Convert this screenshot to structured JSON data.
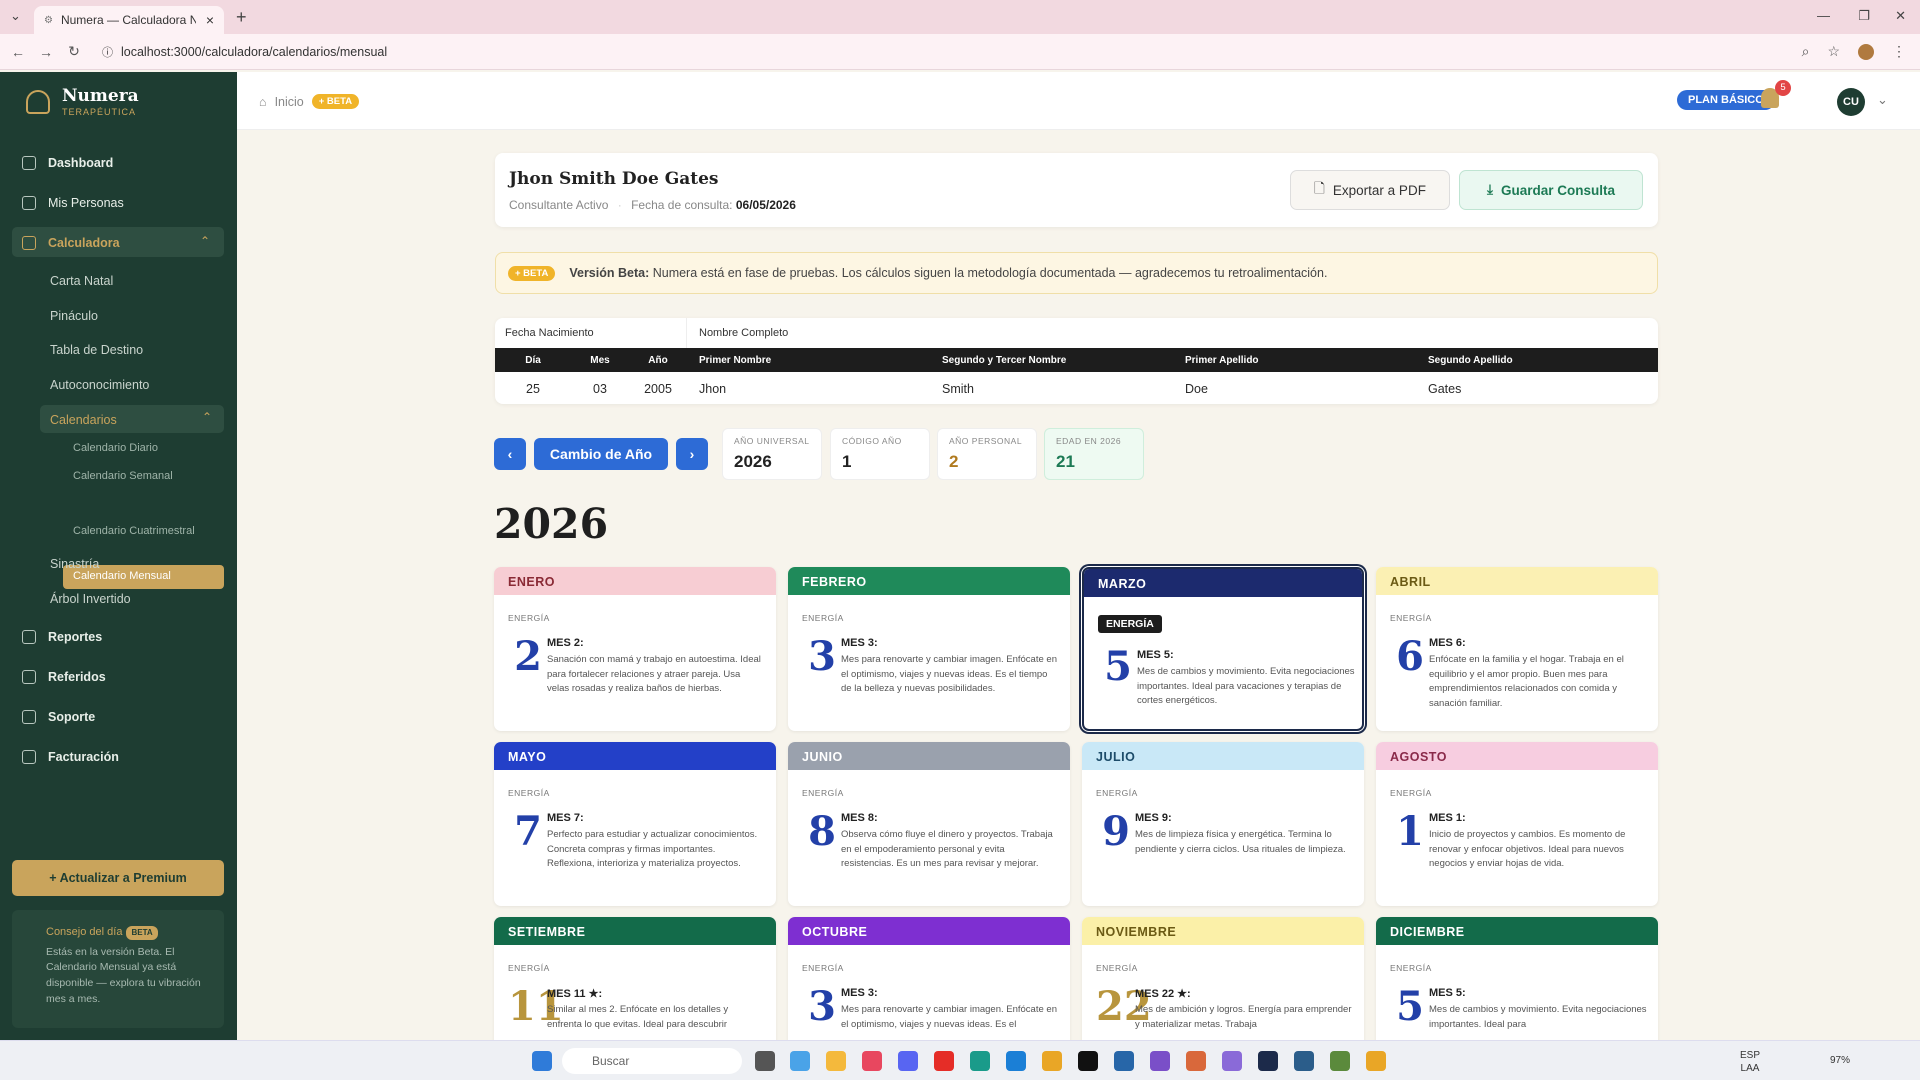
{
  "browser": {
    "tab_title": "Numera — Calculadora Numer",
    "url": "localhost:3000/calculadora/calendarios/mensual"
  },
  "sidebar": {
    "logo_title": "Numera",
    "logo_sub": "TERAPÉUTICA",
    "items": {
      "dashboard": "Dashboard",
      "mis_personas": "Mis Personas",
      "calculadora": "Calculadora",
      "carta_natal": "Carta Natal",
      "pinaculo": "Pináculo",
      "tabla_destino": "Tabla de Destino",
      "autoconocimiento": "Autoconocimiento",
      "calendarios": "Calendarios",
      "cal_diario": "Calendario Diario",
      "cal_semanal": "Calendario Semanal",
      "cal_mensual": "Calendario Mensual",
      "cal_cuatrimestral": "Calendario Cuatrimestral",
      "sinastria": "Sinastría",
      "arbol": "Árbol Invertido",
      "reportes": "Reportes",
      "referidos": "Referidos",
      "soporte": "Soporte",
      "facturacion": "Facturación"
    },
    "premium": "+ Actualizar a Premium",
    "tip_title": "Consejo del día",
    "tip_tag": "BETA",
    "tip_text": "Estás en la versión Beta. El Calendario Mensual ya está disponible — explora tu vibración mes a mes."
  },
  "header": {
    "crumb": "Inicio",
    "beta": "+ BETA",
    "plan": "PLAN BÁSICO",
    "notifications": "5",
    "user_initials": "CU"
  },
  "client": {
    "name": "Jhon Smith Doe Gates",
    "status": "Consultante Activo",
    "date_label": "Fecha de consulta:",
    "date": "06/05/2026",
    "export_label": "Exportar a PDF",
    "save_label": "Guardar Consulta"
  },
  "banner": {
    "tag": "+ BETA",
    "bold": "Versión Beta:",
    "text": "Numera está en fase de pruebas. Los cálculos siguen la metodología documentada — agradecemos tu retroalimentación."
  },
  "birth_table": {
    "group1": "Fecha Nacimiento",
    "group2": "Nombre Completo",
    "headers": [
      "Día",
      "Mes",
      "Año",
      "Primer Nombre",
      "Segundo y Tercer Nombre",
      "Primer Apellido",
      "Segundo Apellido"
    ],
    "values": [
      "25",
      "03",
      "2005",
      "Jhon",
      "Smith",
      "Doe",
      "Gates"
    ]
  },
  "year_nav": {
    "prev": "‹",
    "label": "Cambio de Año",
    "next": "›",
    "stats": [
      {
        "label": "AÑO UNIVERSAL",
        "value": "2026"
      },
      {
        "label": "CÓDIGO AÑO",
        "value": "1"
      },
      {
        "label": "AÑO PERSONAL",
        "value": "2"
      },
      {
        "label": "EDAD EN 2026",
        "value": "21"
      }
    ]
  },
  "year_title": "2026",
  "energy_label": "ENERGÍA",
  "months": [
    {
      "name": "ENERO",
      "num": "2",
      "mes": "MES 2:",
      "desc": "Sanación con mamá y trabajo en autoestima. Ideal para fortalecer relaciones y atraer pareja. Usa velas rosadas y realiza baños de hierbas."
    },
    {
      "name": "FEBRERO",
      "num": "3",
      "mes": "MES 3:",
      "desc": "Mes para renovarte y cambiar imagen. Enfócate en el optimismo, viajes y nuevas ideas. Es el tiempo de la belleza y nuevas posibilidades."
    },
    {
      "name": "MARZO",
      "num": "5",
      "mes": "MES 5:",
      "desc": "Mes de cambios y movimiento. Evita negociaciones importantes. Ideal para vacaciones y terapias de cortes energéticos."
    },
    {
      "name": "ABRIL",
      "num": "6",
      "mes": "MES 6:",
      "desc": "Enfócate en la familia y el hogar. Trabaja en el equilibrio y el amor propio. Buen mes para emprendimientos relacionados con comida y sanación familiar."
    },
    {
      "name": "MAYO",
      "num": "7",
      "mes": "MES 7:",
      "desc": "Perfecto para estudiar y actualizar conocimientos. Concreta compras y firmas importantes. Reflexiona, interioriza y materializa proyectos."
    },
    {
      "name": "JUNIO",
      "num": "8",
      "mes": "MES 8:",
      "desc": "Observa cómo fluye el dinero y proyectos. Trabaja en el empoderamiento personal y evita resistencias. Es un mes para revisar y mejorar."
    },
    {
      "name": "JULIO",
      "num": "9",
      "mes": "MES 9:",
      "desc": "Mes de limpieza física y energética. Termina lo pendiente y cierra ciclos. Usa rituales de limpieza."
    },
    {
      "name": "AGOSTO",
      "num": "1",
      "mes": "MES 1:",
      "desc": "Inicio de proyectos y cambios. Es momento de renovar y enfocar objetivos. Ideal para nuevos negocios y enviar hojas de vida."
    },
    {
      "name": "SETIEMBRE",
      "num": "11",
      "mes": "MES 11 ★:",
      "desc": "Similar al mes 2. Enfócate en los detalles y enfrenta lo que evitas. Ideal para descubrir"
    },
    {
      "name": "OCTUBRE",
      "num": "3",
      "mes": "MES 3:",
      "desc": "Mes para renovarte y cambiar imagen. Enfócate en el optimismo, viajes y nuevas ideas. Es el"
    },
    {
      "name": "NOVIEMBRE",
      "num": "22",
      "mes": "MES 22 ★:",
      "desc": "Mes de ambición y logros. Energía para emprender y materializar metas. Trabaja"
    },
    {
      "name": "DICIEMBRE",
      "num": "5",
      "mes": "MES 5:",
      "desc": "Mes de cambios y movimiento. Evita negociaciones importantes. Ideal para"
    }
  ],
  "taskbar": {
    "search": "Buscar",
    "lang": "ESP",
    "lang2": "LAA",
    "battery": "97%"
  },
  "colors": {
    "sidebar": "#1e3d32",
    "gold": "#c9a45c",
    "blue": "#2d6bd6"
  }
}
